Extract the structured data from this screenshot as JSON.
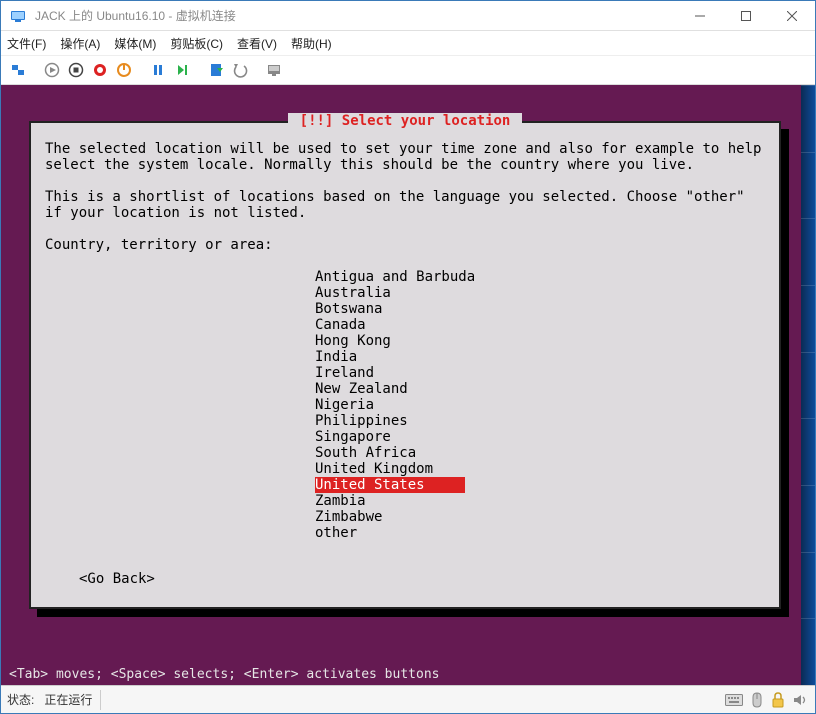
{
  "window": {
    "title": "JACK 上的 Ubuntu16.10 - 虚拟机连接"
  },
  "menu": {
    "file": "文件(F)",
    "action": "操作(A)",
    "media": "媒体(M)",
    "clipboard": "剪贴板(C)",
    "view": "查看(V)",
    "help": "帮助(H)"
  },
  "installer": {
    "title": "[!!] Select your location",
    "para1": "The selected location will be used to set your time zone and also for example to help select the system locale. Normally this should be the country where you live.",
    "para2": "This is a shortlist of locations based on the language you selected. Choose \"other\" if your location is not listed.",
    "prompt": "Country, territory or area:",
    "locations": [
      "Antigua and Barbuda",
      "Australia",
      "Botswana",
      "Canada",
      "Hong Kong",
      "India",
      "Ireland",
      "New Zealand",
      "Nigeria",
      "Philippines",
      "Singapore",
      "South Africa",
      "United Kingdom",
      "United States",
      "Zambia",
      "Zimbabwe",
      "other"
    ],
    "selected_index": 13,
    "go_back": "<Go Back>",
    "hint": "<Tab> moves; <Space> selects; <Enter> activates buttons"
  },
  "status": {
    "label": "状态:",
    "value": "正在运行"
  }
}
